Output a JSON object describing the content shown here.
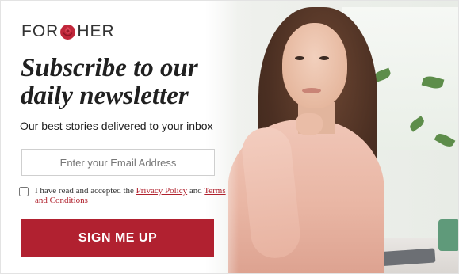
{
  "brand": {
    "name_left": "FOR",
    "name_right": "HER",
    "accent_color": "#b12130",
    "logo_icon": "rose-icon"
  },
  "headline": {
    "line1": "Subscribe to our",
    "line2": "daily newsletter"
  },
  "subheading": "Our best stories delivered to your inbox",
  "email_field": {
    "placeholder": "Enter your Email Address",
    "value": ""
  },
  "consent": {
    "checked": false,
    "text_before": "I have read and accepted the ",
    "privacy_link": "Privacy Policy",
    "text_middle": " and ",
    "terms_link": "Terms and Conditions"
  },
  "cta": {
    "label": "SIGN ME UP"
  }
}
